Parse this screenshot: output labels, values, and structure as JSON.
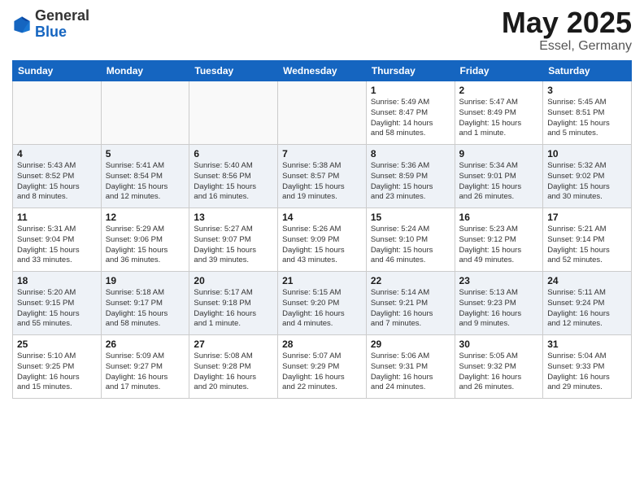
{
  "header": {
    "logo_general": "General",
    "logo_blue": "Blue",
    "month": "May 2025",
    "location": "Essel, Germany"
  },
  "weekdays": [
    "Sunday",
    "Monday",
    "Tuesday",
    "Wednesday",
    "Thursday",
    "Friday",
    "Saturday"
  ],
  "weeks": [
    [
      {
        "day": "",
        "info": ""
      },
      {
        "day": "",
        "info": ""
      },
      {
        "day": "",
        "info": ""
      },
      {
        "day": "",
        "info": ""
      },
      {
        "day": "1",
        "info": "Sunrise: 5:49 AM\nSunset: 8:47 PM\nDaylight: 14 hours\nand 58 minutes."
      },
      {
        "day": "2",
        "info": "Sunrise: 5:47 AM\nSunset: 8:49 PM\nDaylight: 15 hours\nand 1 minute."
      },
      {
        "day": "3",
        "info": "Sunrise: 5:45 AM\nSunset: 8:51 PM\nDaylight: 15 hours\nand 5 minutes."
      }
    ],
    [
      {
        "day": "4",
        "info": "Sunrise: 5:43 AM\nSunset: 8:52 PM\nDaylight: 15 hours\nand 8 minutes."
      },
      {
        "day": "5",
        "info": "Sunrise: 5:41 AM\nSunset: 8:54 PM\nDaylight: 15 hours\nand 12 minutes."
      },
      {
        "day": "6",
        "info": "Sunrise: 5:40 AM\nSunset: 8:56 PM\nDaylight: 15 hours\nand 16 minutes."
      },
      {
        "day": "7",
        "info": "Sunrise: 5:38 AM\nSunset: 8:57 PM\nDaylight: 15 hours\nand 19 minutes."
      },
      {
        "day": "8",
        "info": "Sunrise: 5:36 AM\nSunset: 8:59 PM\nDaylight: 15 hours\nand 23 minutes."
      },
      {
        "day": "9",
        "info": "Sunrise: 5:34 AM\nSunset: 9:01 PM\nDaylight: 15 hours\nand 26 minutes."
      },
      {
        "day": "10",
        "info": "Sunrise: 5:32 AM\nSunset: 9:02 PM\nDaylight: 15 hours\nand 30 minutes."
      }
    ],
    [
      {
        "day": "11",
        "info": "Sunrise: 5:31 AM\nSunset: 9:04 PM\nDaylight: 15 hours\nand 33 minutes."
      },
      {
        "day": "12",
        "info": "Sunrise: 5:29 AM\nSunset: 9:06 PM\nDaylight: 15 hours\nand 36 minutes."
      },
      {
        "day": "13",
        "info": "Sunrise: 5:27 AM\nSunset: 9:07 PM\nDaylight: 15 hours\nand 39 minutes."
      },
      {
        "day": "14",
        "info": "Sunrise: 5:26 AM\nSunset: 9:09 PM\nDaylight: 15 hours\nand 43 minutes."
      },
      {
        "day": "15",
        "info": "Sunrise: 5:24 AM\nSunset: 9:10 PM\nDaylight: 15 hours\nand 46 minutes."
      },
      {
        "day": "16",
        "info": "Sunrise: 5:23 AM\nSunset: 9:12 PM\nDaylight: 15 hours\nand 49 minutes."
      },
      {
        "day": "17",
        "info": "Sunrise: 5:21 AM\nSunset: 9:14 PM\nDaylight: 15 hours\nand 52 minutes."
      }
    ],
    [
      {
        "day": "18",
        "info": "Sunrise: 5:20 AM\nSunset: 9:15 PM\nDaylight: 15 hours\nand 55 minutes."
      },
      {
        "day": "19",
        "info": "Sunrise: 5:18 AM\nSunset: 9:17 PM\nDaylight: 15 hours\nand 58 minutes."
      },
      {
        "day": "20",
        "info": "Sunrise: 5:17 AM\nSunset: 9:18 PM\nDaylight: 16 hours\nand 1 minute."
      },
      {
        "day": "21",
        "info": "Sunrise: 5:15 AM\nSunset: 9:20 PM\nDaylight: 16 hours\nand 4 minutes."
      },
      {
        "day": "22",
        "info": "Sunrise: 5:14 AM\nSunset: 9:21 PM\nDaylight: 16 hours\nand 7 minutes."
      },
      {
        "day": "23",
        "info": "Sunrise: 5:13 AM\nSunset: 9:23 PM\nDaylight: 16 hours\nand 9 minutes."
      },
      {
        "day": "24",
        "info": "Sunrise: 5:11 AM\nSunset: 9:24 PM\nDaylight: 16 hours\nand 12 minutes."
      }
    ],
    [
      {
        "day": "25",
        "info": "Sunrise: 5:10 AM\nSunset: 9:25 PM\nDaylight: 16 hours\nand 15 minutes."
      },
      {
        "day": "26",
        "info": "Sunrise: 5:09 AM\nSunset: 9:27 PM\nDaylight: 16 hours\nand 17 minutes."
      },
      {
        "day": "27",
        "info": "Sunrise: 5:08 AM\nSunset: 9:28 PM\nDaylight: 16 hours\nand 20 minutes."
      },
      {
        "day": "28",
        "info": "Sunrise: 5:07 AM\nSunset: 9:29 PM\nDaylight: 16 hours\nand 22 minutes."
      },
      {
        "day": "29",
        "info": "Sunrise: 5:06 AM\nSunset: 9:31 PM\nDaylight: 16 hours\nand 24 minutes."
      },
      {
        "day": "30",
        "info": "Sunrise: 5:05 AM\nSunset: 9:32 PM\nDaylight: 16 hours\nand 26 minutes."
      },
      {
        "day": "31",
        "info": "Sunrise: 5:04 AM\nSunset: 9:33 PM\nDaylight: 16 hours\nand 29 minutes."
      }
    ]
  ]
}
